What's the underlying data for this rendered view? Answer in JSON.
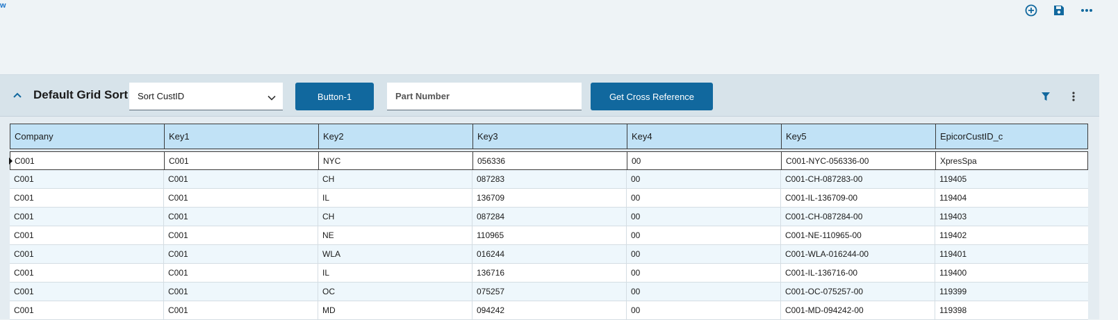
{
  "topbar": {
    "link_text": "w",
    "icons": [
      "add-circle-icon",
      "save-icon",
      "more-horizontal-icon"
    ]
  },
  "panel": {
    "title": "Default Grid Sort",
    "sort_select": {
      "value": "Sort CustID"
    },
    "button1_label": "Button-1",
    "part_number_placeholder": "Part Number",
    "cross_ref_label": "Get Cross Reference",
    "icons": [
      "filter-icon",
      "more-vertical-icon"
    ]
  },
  "grid": {
    "columns": [
      "Company",
      "Key1",
      "Key2",
      "Key3",
      "Key4",
      "Key5",
      "EpicorCustID_c"
    ],
    "rows": [
      [
        "C001",
        "C001",
        "NYC",
        "056336",
        "00",
        "C001-NYC-056336-00",
        "XpresSpa"
      ],
      [
        "C001",
        "C001",
        "CH",
        "087283",
        "00",
        "C001-CH-087283-00",
        "119405"
      ],
      [
        "C001",
        "C001",
        "IL",
        "136709",
        "00",
        "C001-IL-136709-00",
        "119404"
      ],
      [
        "C001",
        "C001",
        "CH",
        "087284",
        "00",
        "C001-CH-087284-00",
        "119403"
      ],
      [
        "C001",
        "C001",
        "NE",
        "110965",
        "00",
        "C001-NE-110965-00",
        "119402"
      ],
      [
        "C001",
        "C001",
        "WLA",
        "016244",
        "00",
        "C001-WLA-016244-00",
        "119401"
      ],
      [
        "C001",
        "C001",
        "IL",
        "136716",
        "00",
        "C001-IL-136716-00",
        "119400"
      ],
      [
        "C001",
        "C001",
        "OC",
        "075257",
        "00",
        "C001-OC-075257-00",
        "119399"
      ],
      [
        "C001",
        "C001",
        "MD",
        "094242",
        "00",
        "C001-MD-094242-00",
        "119398"
      ]
    ]
  },
  "colors": {
    "accent_button": "#11689e",
    "header_row": "#c1e2f6",
    "alt_row": "#eef7fc",
    "icon_blue": "#11689e"
  }
}
